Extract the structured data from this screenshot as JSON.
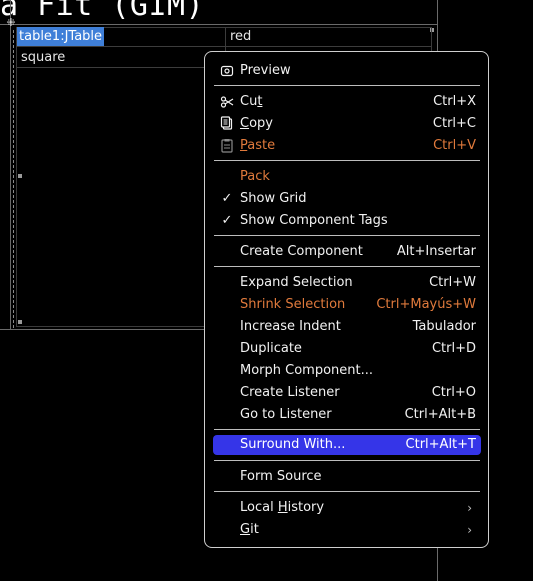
{
  "designer": {
    "form_title_fragment": "a Fit (GIM)",
    "resize_marker": "⁜"
  },
  "table": {
    "component_tag": "table1:JTable",
    "rows": [
      [
        "",
        "red"
      ],
      [
        "square",
        ""
      ]
    ]
  },
  "context_menu": {
    "preview": {
      "icon": "preview-icon",
      "label": "Preview"
    },
    "cut": {
      "icon": "scissors-icon",
      "label_pre": "Cu",
      "label_u": "t",
      "label_post": "",
      "accel": "Ctrl+X"
    },
    "copy": {
      "icon": "copy-icon",
      "label_pre": "",
      "label_u": "C",
      "label_post": "opy",
      "accel": "Ctrl+C"
    },
    "paste": {
      "icon": "paste-icon",
      "label_pre": "",
      "label_u": "P",
      "label_post": "aste",
      "accel": "Ctrl+V",
      "disabled": true
    },
    "pack": {
      "label": "Pack",
      "disabled": true
    },
    "show_grid": {
      "label": "Show Grid",
      "checked": true
    },
    "show_tags": {
      "label": "Show Component Tags",
      "checked": true
    },
    "create_component": {
      "label": "Create Component",
      "accel": "Alt+Insertar"
    },
    "expand_selection": {
      "label": "Expand Selection",
      "accel": "Ctrl+W"
    },
    "shrink_selection": {
      "label": "Shrink Selection",
      "accel": "Ctrl+Mayús+W",
      "disabled": true
    },
    "increase_indent": {
      "label": "Increase Indent",
      "accel": "Tabulador"
    },
    "duplicate": {
      "label": "Duplicate",
      "accel": "Ctrl+D"
    },
    "morph": {
      "label": "Morph Component..."
    },
    "create_listener": {
      "label": "Create Listener",
      "accel": "Ctrl+O"
    },
    "go_to_listener": {
      "label": "Go to Listener",
      "accel": "Ctrl+Alt+B"
    },
    "surround_with": {
      "label": "Surround With...",
      "accel": "Ctrl+Alt+T",
      "selected": true
    },
    "form_source": {
      "label": "Form Source"
    },
    "local_history": {
      "label_pre": "Local ",
      "label_u": "H",
      "label_post": "istory",
      "submenu": true
    },
    "git": {
      "label_pre": "",
      "label_u": "G",
      "label_post": "it",
      "submenu": true
    },
    "checkmark": "✓",
    "submenu_arrow": "›"
  },
  "colors": {
    "selection": "#3535e8",
    "disabled_text": "#e07a3c",
    "tag_highlight": "#3f7fd8",
    "background": "#000000"
  }
}
